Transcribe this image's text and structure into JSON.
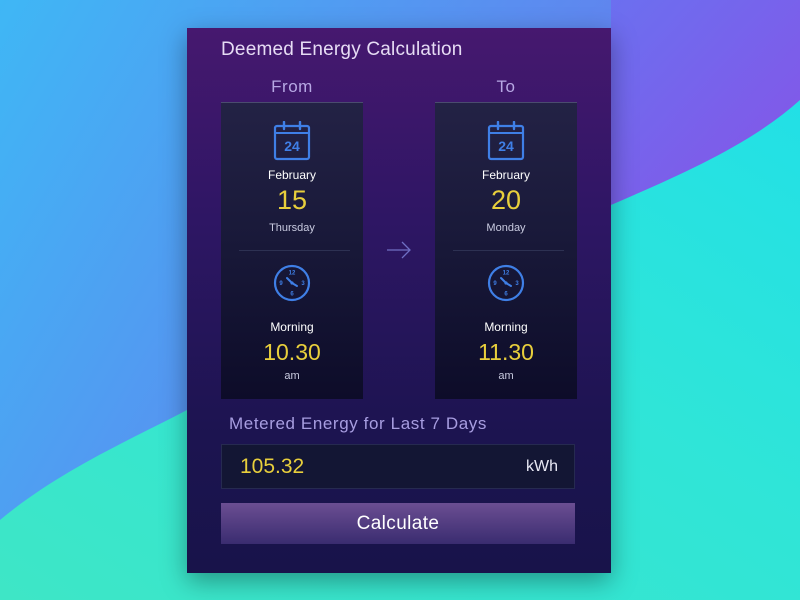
{
  "colors": {
    "accent_yellow": "#e8cf3c",
    "icon_blue": "#3f7fe6",
    "label_lavender": "#a79de0",
    "button_purple": "#6b4e92"
  },
  "card": {
    "title": "Deemed Energy Calculation"
  },
  "from": {
    "heading": "From",
    "calendar_icon_day": "24",
    "month": "February",
    "day": "15",
    "weekday": "Thursday",
    "period": "Morning",
    "time": "10.30",
    "ampm": "am"
  },
  "to": {
    "heading": "To",
    "calendar_icon_day": "24",
    "month": "February",
    "day": "20",
    "weekday": "Monday",
    "period": "Morning",
    "time": "11.30",
    "ampm": "am"
  },
  "metered": {
    "label": "Metered Energy for Last 7 Days",
    "value": "105.32",
    "unit": "kWh"
  },
  "calculate_button": {
    "label": "Calculate"
  },
  "icons": {
    "calendar": "calendar-icon",
    "clock": "clock-icon",
    "arrow": "arrow-right-icon",
    "clock_numbers": [
      "12",
      "3",
      "6",
      "9"
    ]
  }
}
